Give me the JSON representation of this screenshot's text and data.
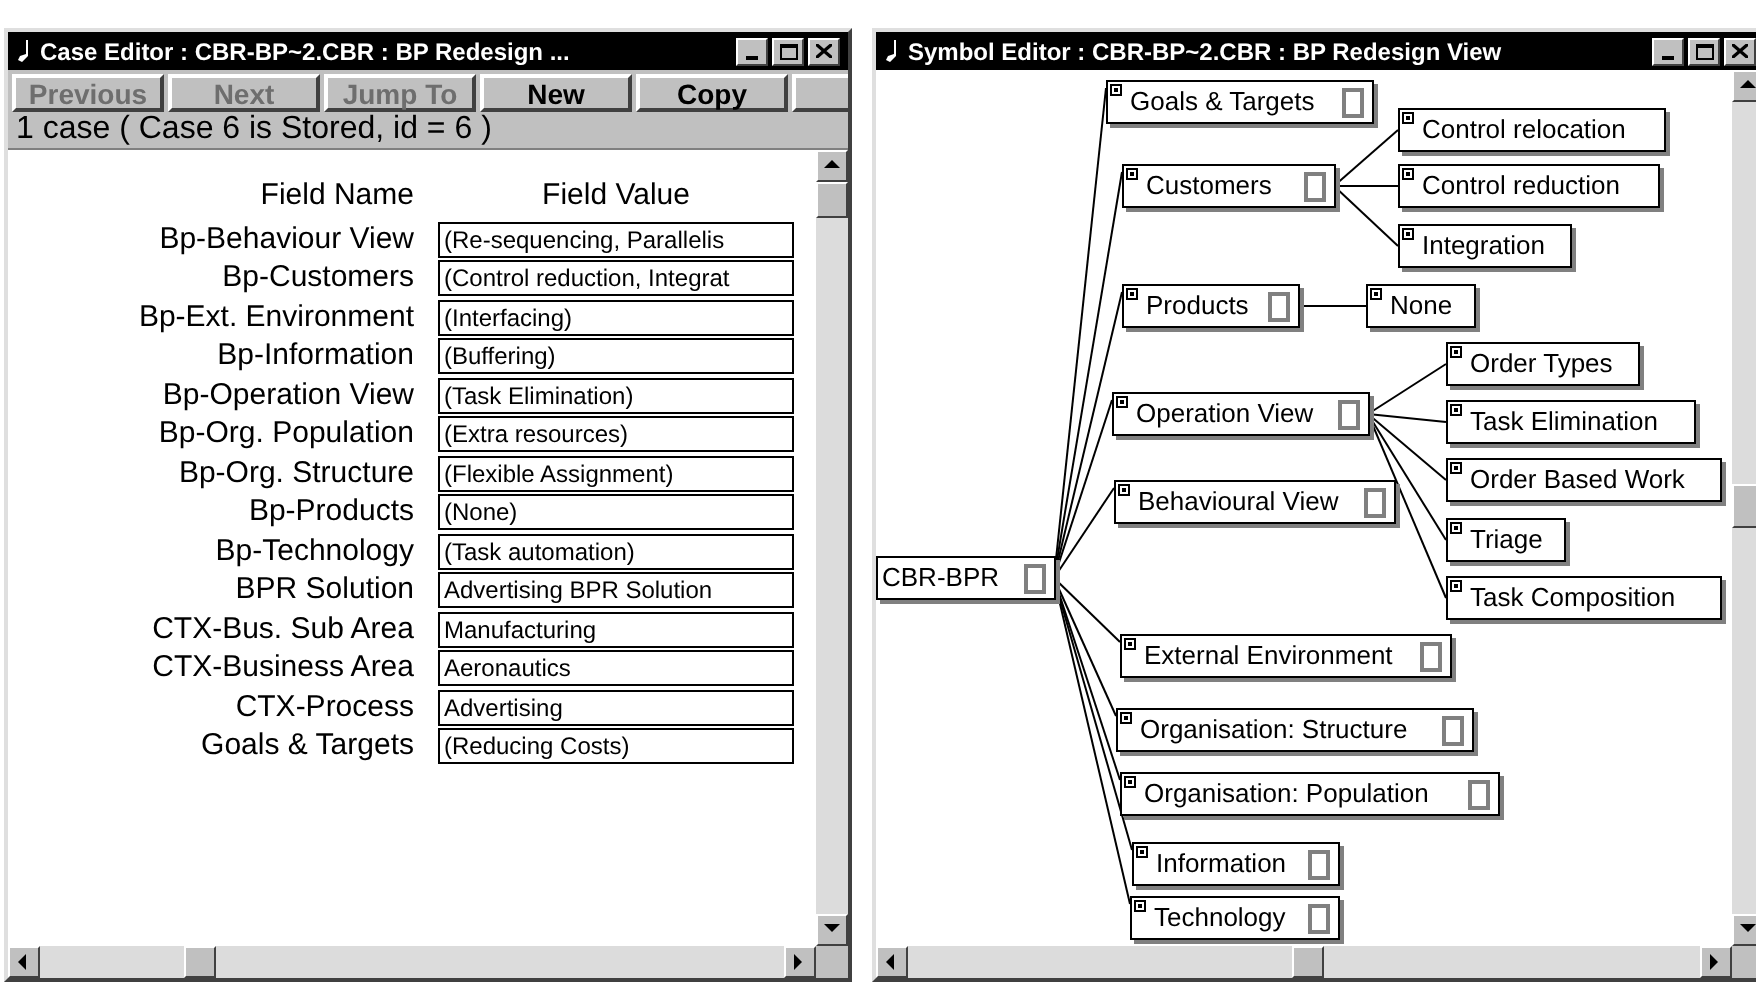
{
  "case_editor": {
    "title": "Case Editor : CBR-BP~2.CBR : BP Redesign ...",
    "buttons": [
      {
        "label": "Previous",
        "disabled": true
      },
      {
        "label": "Next",
        "disabled": true
      },
      {
        "label": "Jump To",
        "disabled": true
      },
      {
        "label": "New",
        "disabled": false
      },
      {
        "label": "Copy",
        "disabled": false
      }
    ],
    "status": "1 case ( Case 6 is Stored, id = 6 )",
    "columns": [
      "Field Name",
      "Field Value"
    ],
    "fields": [
      {
        "name": "Bp-Behaviour View",
        "value": "(Re-sequencing, Parallelis"
      },
      {
        "name": "Bp-Customers",
        "value": "(Control reduction, Integrat"
      },
      {
        "name": "Bp-Ext. Environment",
        "value": "(Interfacing)"
      },
      {
        "name": "Bp-Information",
        "value": "(Buffering)"
      },
      {
        "name": "Bp-Operation View",
        "value": "(Task Elimination)"
      },
      {
        "name": "Bp-Org. Population",
        "value": "(Extra resources)"
      },
      {
        "name": "Bp-Org. Structure",
        "value": "(Flexible Assignment)"
      },
      {
        "name": "Bp-Products",
        "value": "(None)"
      },
      {
        "name": "Bp-Technology",
        "value": "(Task automation)"
      },
      {
        "name": "BPR Solution",
        "value": "Advertising BPR Solution"
      },
      {
        "name": "CTX-Bus. Sub Area",
        "value": "Manufacturing"
      },
      {
        "name": "CTX-Business Area",
        "value": "Aeronautics"
      },
      {
        "name": "CTX-Process",
        "value": "Advertising"
      },
      {
        "name": "Goals & Targets",
        "value": "(Reducing Costs)"
      }
    ]
  },
  "symbol_editor": {
    "title": "Symbol Editor : CBR-BP~2.CBR : BP Redesign View",
    "tree": {
      "label": "CBR-BPR",
      "kind": "root",
      "children": [
        {
          "label": "Goals & Targets",
          "kind": "category"
        },
        {
          "label": "Customers",
          "kind": "category",
          "children": [
            {
              "label": "Control relocation",
              "kind": "value"
            },
            {
              "label": "Control reduction",
              "kind": "value"
            },
            {
              "label": "Integration",
              "kind": "value"
            }
          ]
        },
        {
          "label": "Products",
          "kind": "category",
          "children": [
            {
              "label": "None",
              "kind": "value"
            }
          ]
        },
        {
          "label": "Operation View",
          "kind": "category",
          "children": [
            {
              "label": "Order Types",
              "kind": "value"
            },
            {
              "label": "Task Elimination",
              "kind": "value"
            },
            {
              "label": "Order Based Work",
              "kind": "value"
            },
            {
              "label": "Triage",
              "kind": "value"
            },
            {
              "label": "Task Composition",
              "kind": "value"
            }
          ]
        },
        {
          "label": "Behavioural View",
          "kind": "category"
        },
        {
          "label": "External Environment",
          "kind": "category"
        },
        {
          "label": "Organisation: Structure",
          "kind": "category"
        },
        {
          "label": "Organisation: Population",
          "kind": "category"
        },
        {
          "label": "Information",
          "kind": "category"
        },
        {
          "label": "Technology",
          "kind": "category"
        }
      ]
    }
  }
}
